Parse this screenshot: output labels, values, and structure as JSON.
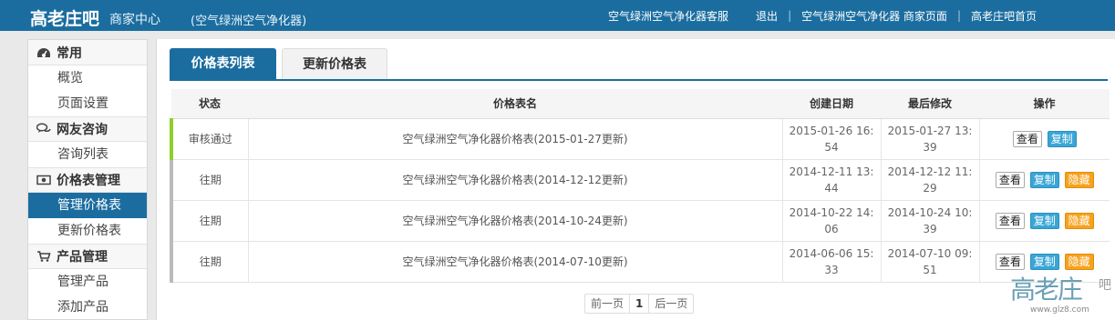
{
  "header": {
    "brand": "高老庄吧",
    "brand_sub": "商家中心",
    "shop_name": "(空气绿洲空气净化器)",
    "links": {
      "service": "空气绿洲空气净化器客服",
      "logout": "退出",
      "shop_page": "空气绿洲空气净化器 商家页面",
      "home": "高老庄吧首页"
    }
  },
  "sidebar": {
    "sections": [
      {
        "title": "常用",
        "icon": "dashboard-icon",
        "items": [
          "概览",
          "页面设置"
        ]
      },
      {
        "title": "网友咨询",
        "icon": "chat-icon",
        "items": [
          "咨询列表"
        ]
      },
      {
        "title": "价格表管理",
        "icon": "money-icon",
        "items": [
          "管理价格表",
          "更新价格表"
        ],
        "active_item": "管理价格表"
      },
      {
        "title": "产品管理",
        "icon": "cart-icon",
        "items": [
          "管理产品",
          "添加产品"
        ]
      }
    ]
  },
  "tabs": {
    "list": "价格表列表",
    "update": "更新价格表"
  },
  "table": {
    "headers": {
      "status": "状态",
      "name": "价格表名",
      "created": "创建日期",
      "modified": "最后修改",
      "actions": "操作"
    },
    "rows": [
      {
        "status": "审核通过",
        "name": "空气绿洲空气净化器价格表(2015-01-27更新)",
        "created": "2015-01-26 16:54",
        "modified": "2015-01-27 13:39",
        "view": "查看",
        "copy": "复制",
        "hide": ""
      },
      {
        "status": "往期",
        "name": "空气绿洲空气净化器价格表(2014-12-12更新)",
        "created": "2014-12-11 13:44",
        "modified": "2014-12-12 11:29",
        "view": "查看",
        "copy": "复制",
        "hide": "隐藏"
      },
      {
        "status": "往期",
        "name": "空气绿洲空气净化器价格表(2014-10-24更新)",
        "created": "2014-10-22 14:06",
        "modified": "2014-10-24 10:39",
        "view": "查看",
        "copy": "复制",
        "hide": "隐藏"
      },
      {
        "status": "往期",
        "name": "空气绿洲空气净化器价格表(2014-07-10更新)",
        "created": "2014-06-06 15:33",
        "modified": "2014-07-10 09:51",
        "view": "查看",
        "copy": "复制",
        "hide": "隐藏"
      }
    ]
  },
  "pager": {
    "prev": "前一页",
    "current": "1",
    "next": "后一页"
  },
  "watermark": {
    "big": "高老庄",
    "tail": "吧",
    "url": "www.glz8.com"
  },
  "colors": {
    "primary": "#1b6d9f",
    "copy_button": "#3aa6d6",
    "hide_button": "#f7a21e",
    "approved_marker": "#8fcf2a"
  }
}
